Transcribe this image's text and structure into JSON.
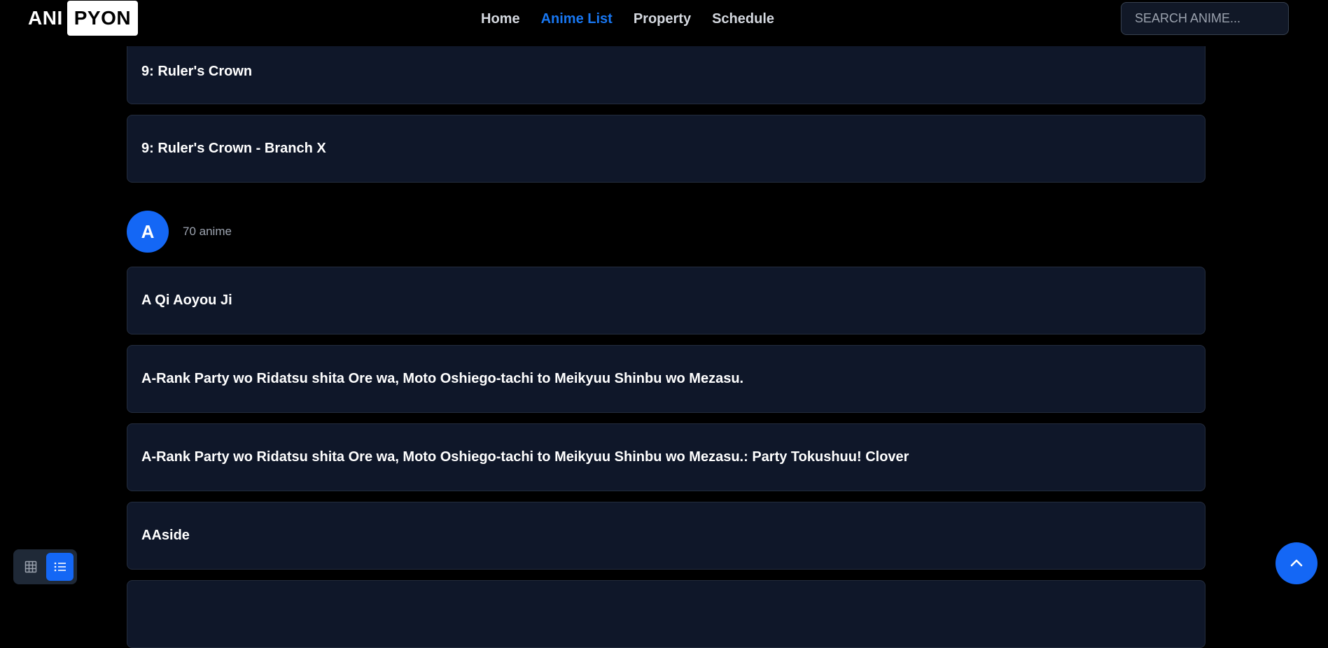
{
  "brand": {
    "part1": "ANI",
    "part2": "PYON"
  },
  "nav": {
    "items": [
      {
        "label": "Home",
        "active": false
      },
      {
        "label": "Anime List",
        "active": true
      },
      {
        "label": "Property",
        "active": false
      },
      {
        "label": "Schedule",
        "active": false
      }
    ]
  },
  "search": {
    "placeholder": "SEARCH ANIME...",
    "value": ""
  },
  "list": {
    "previous_items": [
      {
        "title": "9: Ruler's Crown"
      },
      {
        "title": "9: Ruler's Crown - Branch X"
      }
    ],
    "section": {
      "letter": "A",
      "count_label": "70 anime"
    },
    "items": [
      {
        "title": "A Qi Aoyou Ji"
      },
      {
        "title": "A-Rank Party wo Ridatsu shita Ore wa, Moto Oshiego-tachi to Meikyuu Shinbu wo Mezasu."
      },
      {
        "title": "A-Rank Party wo Ridatsu shita Ore wa, Moto Oshiego-tachi to Meikyuu Shinbu wo Mezasu.: Party Tokushuu! Clover"
      },
      {
        "title": "AAside"
      }
    ]
  },
  "view_toggle": {
    "modes": [
      {
        "icon": "grid-icon",
        "active": false
      },
      {
        "icon": "list-icon",
        "active": true
      }
    ]
  },
  "scroll_top": {
    "icon": "chevron-up-icon"
  },
  "colors": {
    "background": "#000000",
    "card": "#0f1729",
    "card_border": "#232c3d",
    "accent": "#1467f5",
    "nav_active": "#1877f2",
    "muted_text": "#9ca3af"
  }
}
